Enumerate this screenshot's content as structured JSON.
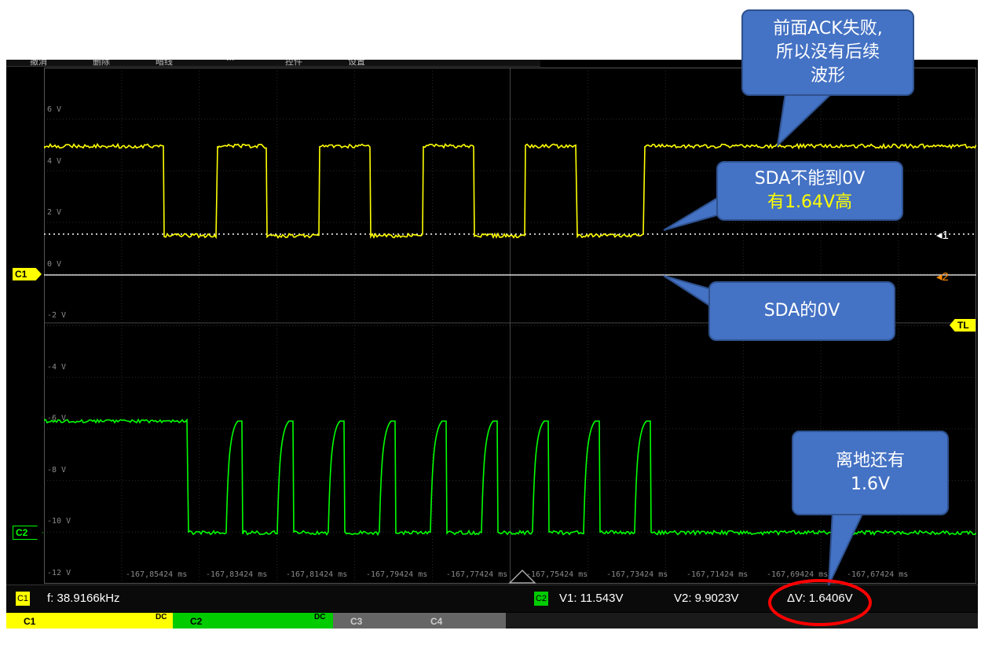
{
  "menu": {
    "items": [
      "撤消",
      "删除",
      "暗线",
      "···",
      "控件",
      "设置"
    ]
  },
  "plot": {
    "voltage_labels": [
      "6 V",
      "4 V",
      "2 V",
      "0 V",
      "-2 V",
      "-4 V",
      "-6 V",
      "-8 V",
      "-10 V",
      "-12 V"
    ],
    "time_labels": [
      "-167,85424 ms",
      "-167,83424 ms",
      "-167,81424 ms",
      "-167,79424 ms",
      "-167,77424 ms",
      "-167,75424 ms",
      "-167,73424 ms",
      "-167,71424 ms",
      "-167,69424 ms",
      "-167,67424 ms"
    ]
  },
  "markers": {
    "c1": "C1",
    "c2": "C2",
    "cursor1": "1",
    "cursor2": "2",
    "trigger_level": "TL"
  },
  "measurements": {
    "c1_badge": "C1",
    "frequency": "f: 38.9166kHz",
    "c2_badge": "C2",
    "v1": "V1: 11.543V",
    "v2": "V2: 9.9023V",
    "delta_v": "ΔV: 1.6406V"
  },
  "channel_tabs": [
    {
      "label": "C1",
      "dc": "DC"
    },
    {
      "label": "C2",
      "dc": "DC"
    },
    {
      "label": "C3"
    },
    {
      "label": "C4"
    }
  ],
  "annotations": {
    "ack_failed": [
      "前面ACK失败,",
      "所以没有后续",
      "波形"
    ],
    "sda_not_zero_line1": "SDA不能到0V",
    "sda_not_zero_line2": "有1.64V高",
    "sda_zero": "SDA的0V",
    "ground_offset": [
      "离地还有",
      "1.6V"
    ]
  },
  "colors": {
    "channel1": "#ffff00",
    "channel2": "#00ff00",
    "cursor2": "#ff8c00",
    "callout": "#4472c4",
    "callout_highlight": "#ffff00",
    "circle": "#ff0000"
  }
}
